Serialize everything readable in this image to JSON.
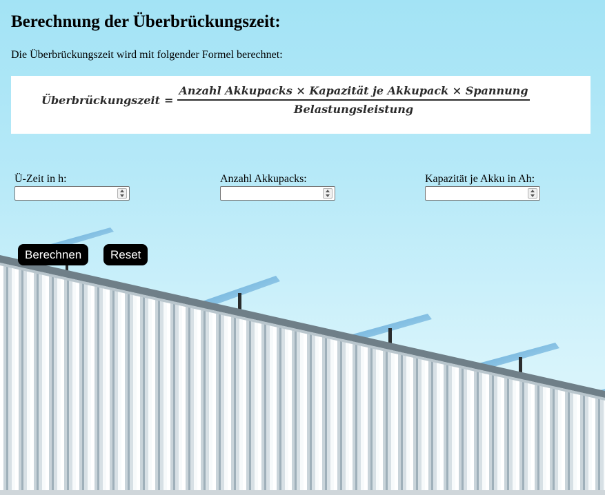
{
  "page": {
    "title": "Berechnung der Überbrückungszeit:",
    "intro": "Die Überbrückungszeit wird mit folgender Formel berechnet:"
  },
  "formula": {
    "lhs": "Überbrückungszeit",
    "equals": "=",
    "numerator": "Anzahl Akkupacks × Kapazität je Akkupack × Spannung",
    "denominator": "Belastungsleistung"
  },
  "fields": [
    {
      "label": "Ü-Zeit in h:",
      "value": "",
      "placeholder": ""
    },
    {
      "label": "Anzahl Akkupacks:",
      "value": "",
      "placeholder": ""
    },
    {
      "label": "Kapazität je Akku in Ah:",
      "value": "",
      "placeholder": ""
    }
  ],
  "buttons": {
    "calculate": "Berechnen",
    "reset": "Reset"
  },
  "colors": {
    "sky": "#a3e3f5",
    "button_bg": "#000000",
    "button_text": "#ffffff",
    "wall": "#dfe6ea"
  }
}
